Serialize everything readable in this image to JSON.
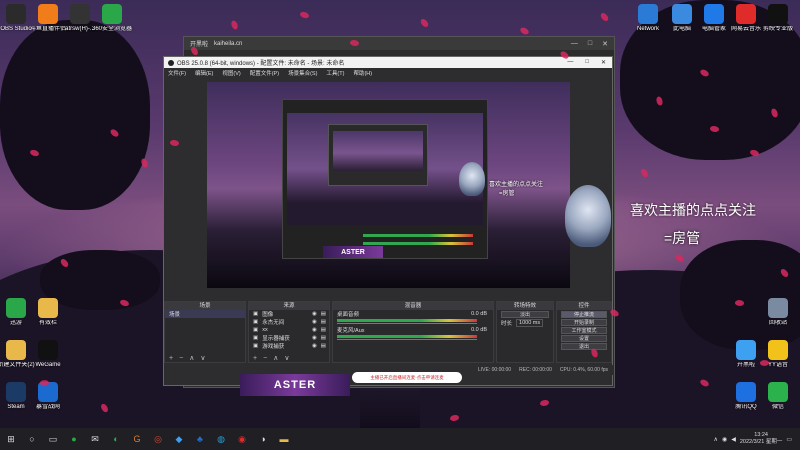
{
  "desktop_icons_top_left": [
    {
      "icon": "obs-icon",
      "label": "OBS Studio",
      "color": "#2b2b2b"
    },
    {
      "icon": "live-assistant-icon",
      "label": "斗鱼直播伴侣",
      "color": "#f07d1a"
    },
    {
      "icon": "shortcut-icon",
      "label": "atrsw(H)-...",
      "color": "#333"
    },
    {
      "icon": "360-browser-icon",
      "label": "360安全浏览器",
      "color": "#2aa748"
    }
  ],
  "desktop_icons_top_right": [
    {
      "icon": "network-icon",
      "label": "Network",
      "color": "#2b7bd6"
    },
    {
      "icon": "computer-icon",
      "label": "此电脑",
      "color": "#3a8be0"
    },
    {
      "icon": "pc-manager-icon",
      "label": "电脑管家",
      "color": "#1f7ae8"
    },
    {
      "icon": "netease-music-icon",
      "label": "网易云音乐",
      "color": "#e02b2b"
    },
    {
      "icon": "capcut-icon",
      "label": "剪映专业版",
      "color": "#111"
    }
  ],
  "desktop_icons_left": [
    {
      "icon": "360-security-icon",
      "label": "迅游",
      "color": "#2aa748"
    },
    {
      "icon": "folder-icon",
      "label": "有效栏",
      "color": "#e8b84a"
    },
    {
      "icon": "new-folder-icon",
      "label": "新建文件夹(2)",
      "color": "#e8b84a"
    },
    {
      "icon": "wegame-icon",
      "label": "WeGame",
      "color": "#111"
    },
    {
      "icon": "steam-icon",
      "label": "Steam",
      "color": "#1b3b66"
    },
    {
      "icon": "netease-bubble-icon",
      "label": "暴雪战网",
      "color": "#1a6ad0"
    }
  ],
  "desktop_icons_right": [
    {
      "icon": "recycle-bin-icon",
      "label": "回收站",
      "color": "#7a8aa0"
    },
    {
      "icon": "kaiheila-icon",
      "label": "开黑啦",
      "color": "#3ea0f0"
    },
    {
      "icon": "yy-icon",
      "label": "YY语音",
      "color": "#f2c21b"
    },
    {
      "icon": "qq-icon",
      "label": "腾讯QQ",
      "color": "#1e6fe0"
    },
    {
      "icon": "wechat-icon",
      "label": "微信",
      "color": "#2bb24c"
    }
  ],
  "viewer_window": {
    "title": "开黑啦",
    "subtitle": "kaiheila.cn",
    "controls": [
      "—",
      "□",
      "✕"
    ]
  },
  "obs": {
    "title": "OBS 25.0.8 (64-bit, windows) - 配置文件: 未命名 - 场景: 未命名",
    "controls": [
      "—",
      "□",
      "✕"
    ],
    "menu": [
      "文件(F)",
      "编辑(E)",
      "视图(V)",
      "配置文件(P)",
      "场景集合(S)",
      "工具(T)",
      "帮助(H)"
    ],
    "docks": {
      "scenes": {
        "title": "场景",
        "items": [
          "场景"
        ]
      },
      "sources": {
        "title": "来源",
        "items": [
          "图像",
          "永杰无间",
          "xx",
          "显示器捕获",
          "游戏捕获"
        ]
      },
      "mixer": {
        "title": "混音器",
        "tracks": [
          {
            "name": "桌面音频",
            "db": "0.0 dB"
          },
          {
            "name": "麦克风/Aux",
            "db": "0.0 dB"
          }
        ]
      },
      "transitions": {
        "title": "转场特效",
        "type": "淡出",
        "duration_label": "时长",
        "duration": "1000 ms"
      },
      "controls": {
        "title": "控件",
        "buttons": [
          "停止推流",
          "开始录制",
          "工作室模式",
          "设置",
          "退出"
        ]
      }
    },
    "status": {
      "live": "LIVE: 00:00:00",
      "rec": "REC: 00:00:00",
      "cpu": "CPU: 0.4%, 60.00 fps"
    },
    "footer_buttons": [
      "+",
      "−",
      "∧",
      "∨"
    ]
  },
  "overlay": {
    "follow_text": "喜欢主播的点点关注",
    "room_text": "=房管",
    "banner_text": "主播已开启直播间连麦·点击申请连麦",
    "aster_text": "ASTER"
  },
  "taskbar": {
    "apps": [
      "start-icon",
      "search-icon",
      "task-view-icon",
      "360-icon",
      "chat-icon",
      "wechat-icon",
      "game-icon",
      "chrome-icon",
      "kaiheila-icon",
      "qq-icon",
      "browser-icon",
      "netease-icon",
      "obs-icon",
      "folder-icon"
    ],
    "time": "13:24",
    "date": "2022/3/21 星期一"
  }
}
